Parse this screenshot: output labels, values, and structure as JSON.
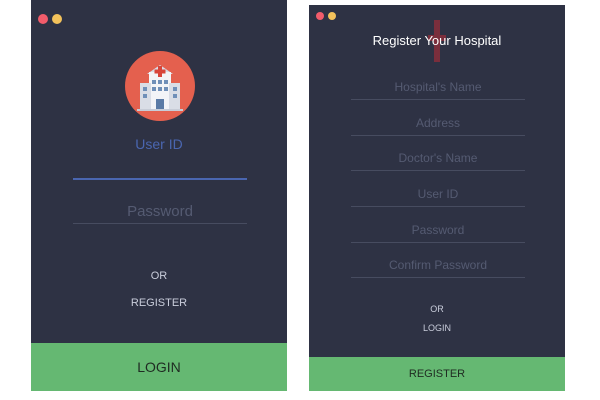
{
  "colors": {
    "window_bg": "#2e3244",
    "accent_blue": "#4a66b0",
    "button_green": "#65b872",
    "logo_red": "#e4604e"
  },
  "login": {
    "user_id_label": "User ID",
    "password_placeholder": "Password",
    "or_text": "OR",
    "register_link": "REGISTER",
    "login_button": "LOGIN",
    "logo_icon": "hospital-icon"
  },
  "register": {
    "title": "Register Your Hospital",
    "fields": {
      "hospital_name": "Hospital's Name",
      "address": "Address",
      "doctor_name": "Doctor's Name",
      "user_id": "User ID",
      "password": "Password",
      "confirm_password": "Confirm Password"
    },
    "or_text": "OR",
    "login_link": "LOGIN",
    "register_button": "REGISTER"
  }
}
